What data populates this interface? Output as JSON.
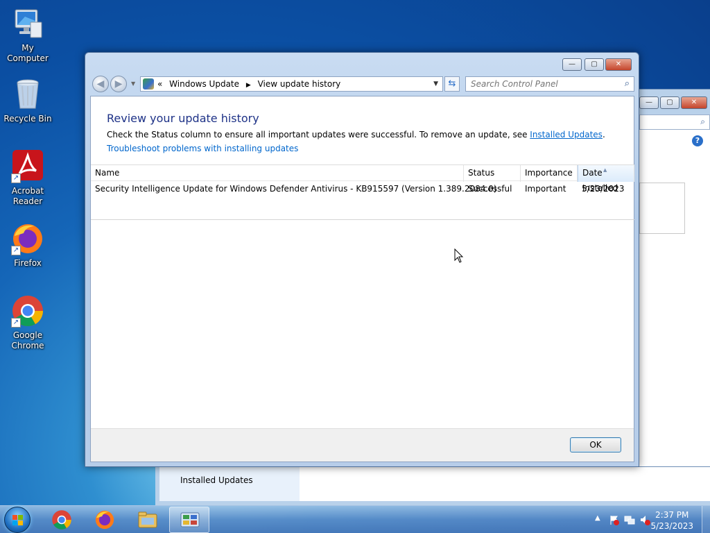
{
  "desktop": {
    "icons": [
      {
        "label": "My Computer"
      },
      {
        "label": "Recycle Bin"
      },
      {
        "label": "Acrobat Reader"
      },
      {
        "label": "Firefox"
      },
      {
        "label": "Google Chrome"
      }
    ]
  },
  "background_window": {
    "installed_updates_label": "Installed Updates"
  },
  "window": {
    "address": {
      "chevrons": "«",
      "segments": [
        "Windows Update",
        "View update history"
      ]
    },
    "search": {
      "placeholder": "Search Control Panel"
    },
    "page_title": "Review your update history",
    "description_text": "Check the Status column to ensure all important updates were successful. To remove an update, see ",
    "installed_updates_link": "Installed Updates",
    "description_end": ".",
    "troubleshoot_link": "Troubleshoot problems with installing updates",
    "columns": [
      "Name",
      "Status",
      "Importance",
      "Date Installed"
    ],
    "rows": [
      {
        "name": "Security Intelligence Update for Windows Defender Antivirus - KB915597 (Version 1.389.2084.0)",
        "status": "Successful",
        "importance": "Important",
        "date_installed": "5/23/2023"
      }
    ],
    "ok_label": "OK"
  },
  "taskbar": {
    "items": [
      "chrome-icon",
      "firefox-icon",
      "file-explorer-icon",
      "control-panel-icon"
    ],
    "clock": {
      "time": "2:37 PM",
      "date": "5/23/2023"
    }
  },
  "colors": {
    "title_blue": "#1e3287",
    "link_blue": "#0066cc",
    "desktop_blue": "#1566b8"
  }
}
